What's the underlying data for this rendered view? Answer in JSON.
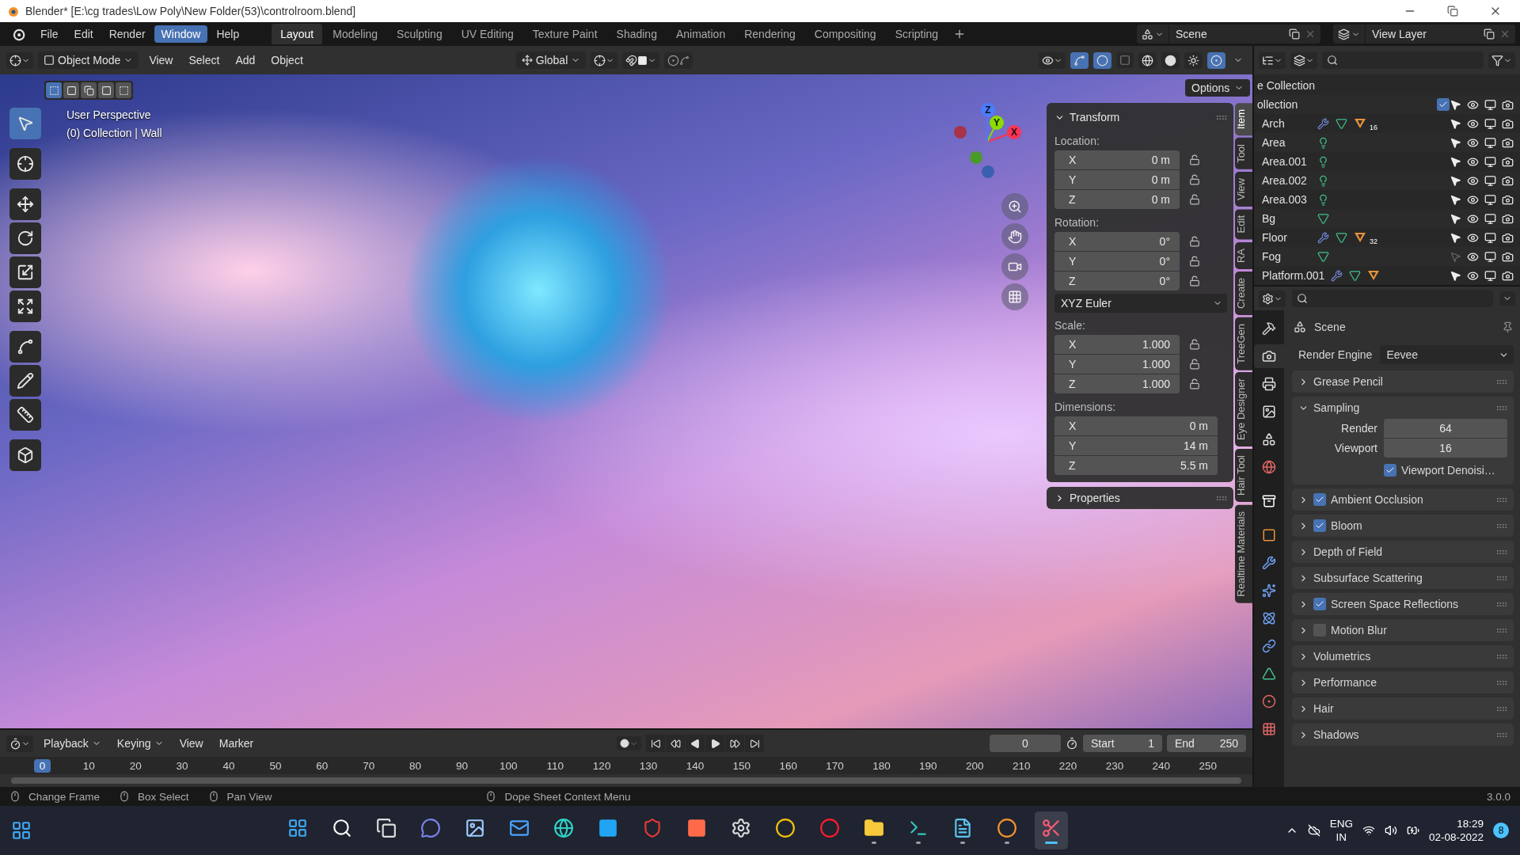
{
  "title_bar": {
    "title": "Blender* [E:\\cg trades\\Low Poly\\New Folder(53)\\controlroom.blend]"
  },
  "menus": [
    {
      "label": "File",
      "selected": false
    },
    {
      "label": "Edit",
      "selected": false
    },
    {
      "label": "Render",
      "selected": false
    },
    {
      "label": "Window",
      "selected": true
    },
    {
      "label": "Help",
      "selected": false
    }
  ],
  "workspaces": [
    {
      "label": "Layout",
      "selected": true
    },
    {
      "label": "Modeling",
      "selected": false
    },
    {
      "label": "Sculpting",
      "selected": false
    },
    {
      "label": "UV Editing",
      "selected": false
    },
    {
      "label": "Texture Paint",
      "selected": false
    },
    {
      "label": "Shading",
      "selected": false
    },
    {
      "label": "Animation",
      "selected": false
    },
    {
      "label": "Rendering",
      "selected": false
    },
    {
      "label": "Compositing",
      "selected": false
    },
    {
      "label": "Scripting",
      "selected": false
    }
  ],
  "scene": "Scene",
  "view_layer": "View Layer",
  "viewport": {
    "mode": "Object Mode",
    "menus": [
      "View",
      "Select",
      "Add",
      "Object"
    ],
    "orientation": "Global",
    "options": "Options",
    "info": [
      "User Perspective",
      "(0) Collection | Wall"
    ],
    "gizmo_axes": [
      "X",
      "Y",
      "Z"
    ],
    "tools": [
      {
        "kind": "select",
        "selected": true
      },
      {
        "kind": "cursor",
        "selected": false
      },
      {
        "kind": "move",
        "selected": false
      },
      {
        "kind": "rotate",
        "selected": false
      },
      {
        "kind": "scale",
        "selected": false
      },
      {
        "kind": "transform",
        "selected": false
      },
      {
        "kind": "annotate_line",
        "selected": false
      },
      {
        "kind": "annotate",
        "selected": false
      },
      {
        "kind": "measure",
        "selected": false
      },
      {
        "kind": "add_cube",
        "selected": false
      }
    ],
    "sidebar_tabs": [
      {
        "label": "Item",
        "selected": true
      },
      {
        "label": "Tool",
        "selected": false
      },
      {
        "label": "View",
        "selected": false
      },
      {
        "label": "Edit",
        "selected": false
      },
      {
        "label": "RA",
        "selected": false
      },
      {
        "label": "Create",
        "selected": false
      },
      {
        "label": "TreeGen",
        "selected": false
      },
      {
        "label": "Eye Designer",
        "selected": false
      },
      {
        "label": "Hair Tool",
        "selected": false
      },
      {
        "label": "Realtime Materials",
        "selected": false
      }
    ],
    "transform": {
      "title": "Transform",
      "expanded": true,
      "groups": [
        {
          "label": "Location:",
          "locks": true,
          "fields": [
            {
              "axis": "X",
              "value": "0 m"
            },
            {
              "axis": "Y",
              "value": "0 m"
            },
            {
              "axis": "Z",
              "value": "0 m"
            }
          ]
        },
        {
          "label": "Rotation:",
          "locks": true,
          "fields": [
            {
              "axis": "X",
              "value": "0°"
            },
            {
              "axis": "Y",
              "value": "0°"
            },
            {
              "axis": "Z",
              "value": "0°"
            }
          ],
          "mode": "XYZ Euler"
        },
        {
          "label": "Scale:",
          "locks": true,
          "fields": [
            {
              "axis": "X",
              "value": "1.000"
            },
            {
              "axis": "Y",
              "value": "1.000"
            },
            {
              "axis": "Z",
              "value": "1.000"
            }
          ]
        },
        {
          "label": "Dimensions:",
          "locks": false,
          "fields": [
            {
              "axis": "X",
              "value": "0 m"
            },
            {
              "axis": "Y",
              "value": "14 m"
            },
            {
              "axis": "Z",
              "value": "5.5 m"
            }
          ]
        }
      ],
      "more": {
        "title": "Properties",
        "expanded": false
      }
    }
  },
  "outliner": {
    "rows": [
      {
        "kind": "scene_collection",
        "name": "e Collection"
      },
      {
        "kind": "collection",
        "name": "ollection",
        "checked": true
      },
      {
        "kind": "mesh",
        "name": "Arch",
        "modifier": true,
        "material": true,
        "material_count": "16",
        "selectable": true
      },
      {
        "kind": "light",
        "name": "Area",
        "selectable": true
      },
      {
        "kind": "light",
        "name": "Area.001",
        "selectable": true
      },
      {
        "kind": "light",
        "name": "Area.002",
        "selectable": true
      },
      {
        "kind": "light",
        "name": "Area.003",
        "selectable": true
      },
      {
        "kind": "mesh",
        "name": "Bg",
        "modifier": false,
        "material": false,
        "selectable": true
      },
      {
        "kind": "mesh",
        "name": "Floor",
        "modifier": true,
        "material": true,
        "material_count": "32",
        "selectable": true
      },
      {
        "kind": "mesh",
        "name": "Fog",
        "modifier": false,
        "material": false,
        "selectable": false
      },
      {
        "kind": "mesh",
        "name": "Platform.001",
        "modifier": true,
        "material": true,
        "selectable": true
      }
    ]
  },
  "properties": {
    "tabs": [
      {
        "kind": "tool",
        "selected": false
      },
      {
        "kind": "render",
        "selected": true
      },
      {
        "kind": "output",
        "selected": false
      },
      {
        "kind": "view_layer",
        "selected": false
      },
      {
        "kind": "scene",
        "selected": false
      },
      {
        "kind": "world",
        "selected": false
      },
      {
        "kind": "collection",
        "selected": false
      },
      {
        "kind": "object",
        "selected": false
      },
      {
        "kind": "modifier",
        "selected": false
      },
      {
        "kind": "particles",
        "selected": false
      },
      {
        "kind": "physics",
        "selected": false
      },
      {
        "kind": "constraints",
        "selected": false
      },
      {
        "kind": "data",
        "selected": false
      },
      {
        "kind": "material",
        "selected": false
      },
      {
        "kind": "texture",
        "selected": false
      }
    ],
    "context": "Scene",
    "engine_label": "Render Engine",
    "engine": "Eevee",
    "panels": [
      {
        "label": "Grease Pencil",
        "kind": "plain",
        "expanded": false
      },
      {
        "label": "Sampling",
        "kind": "plain",
        "expanded": true,
        "fields": [
          {
            "label": "Render",
            "value": "64"
          },
          {
            "label": "Viewport",
            "value": "16"
          }
        ],
        "options": [
          {
            "label": "Viewport Denoisi…",
            "checked": true
          }
        ]
      },
      {
        "label": "Ambient Occlusion",
        "kind": "toggle",
        "checked": true,
        "expanded": false
      },
      {
        "label": "Bloom",
        "kind": "toggle",
        "checked": true,
        "expanded": false
      },
      {
        "label": "Depth of Field",
        "kind": "plain",
        "expanded": false
      },
      {
        "label": "Subsurface Scattering",
        "kind": "plain",
        "expanded": false
      },
      {
        "label": "Screen Space Reflections",
        "kind": "toggle",
        "checked": true,
        "expanded": false
      },
      {
        "label": "Motion Blur",
        "kind": "toggle",
        "checked": false,
        "expanded": false
      },
      {
        "label": "Volumetrics",
        "kind": "plain",
        "expanded": false
      },
      {
        "label": "Performance",
        "kind": "plain",
        "expanded": false
      },
      {
        "label": "Hair",
        "kind": "plain",
        "expanded": false
      },
      {
        "label": "Shadows",
        "kind": "plain",
        "expanded": false
      }
    ]
  },
  "timeline": {
    "menus": [
      {
        "label": "Playback",
        "dropdown": true
      },
      {
        "label": "Keying",
        "dropdown": true
      },
      {
        "label": "View",
        "dropdown": false
      },
      {
        "label": "Marker",
        "dropdown": false
      }
    ],
    "current_frame": "0",
    "start_label": "Start",
    "start": "1",
    "end_label": "End",
    "end": "250",
    "frames": [
      {
        "label": "0",
        "selected": true
      },
      {
        "label": "10",
        "selected": false
      },
      {
        "label": "20",
        "selected": false
      },
      {
        "label": "30",
        "selected": false
      },
      {
        "label": "40",
        "selected": false
      },
      {
        "label": "50",
        "selected": false
      },
      {
        "label": "60",
        "selected": false
      },
      {
        "label": "70",
        "selected": false
      },
      {
        "label": "80",
        "selected": false
      },
      {
        "label": "90",
        "selected": false
      },
      {
        "label": "100",
        "selected": false
      },
      {
        "label": "110",
        "selected": false
      },
      {
        "label": "120",
        "selected": false
      },
      {
        "label": "130",
        "selected": false
      },
      {
        "label": "140",
        "selected": false
      },
      {
        "label": "150",
        "selected": false
      },
      {
        "label": "160",
        "selected": false
      },
      {
        "label": "170",
        "selected": false
      },
      {
        "label": "180",
        "selected": false
      },
      {
        "label": "190",
        "selected": false
      },
      {
        "label": "200",
        "selected": false
      },
      {
        "label": "210",
        "selected": false
      },
      {
        "label": "220",
        "selected": false
      },
      {
        "label": "230",
        "selected": false
      },
      {
        "label": "240",
        "selected": false
      },
      {
        "label": "250",
        "selected": false
      }
    ]
  },
  "status_bar": {
    "hints": [
      "Change Frame",
      "Box Select",
      "Pan View",
      "Dope Sheet Context Menu"
    ],
    "version": "3.0.0"
  },
  "taskbar": {
    "apps": [
      {
        "kind": "start",
        "running": false
      },
      {
        "kind": "search",
        "running": false
      },
      {
        "kind": "task_view",
        "running": false
      },
      {
        "kind": "chat",
        "running": false
      },
      {
        "kind": "photos",
        "running": false
      },
      {
        "kind": "mail",
        "running": false
      },
      {
        "kind": "browser",
        "running": false
      },
      {
        "kind": "learning",
        "running": false
      },
      {
        "kind": "antivirus",
        "running": false
      },
      {
        "kind": "editor",
        "running": false
      },
      {
        "kind": "settings",
        "running": false
      },
      {
        "kind": "web",
        "running": false
      },
      {
        "kind": "opera",
        "running": false
      },
      {
        "kind": "folder",
        "running": true
      },
      {
        "kind": "terminal",
        "running": true
      },
      {
        "kind": "notepad",
        "running": true
      },
      {
        "kind": "blender",
        "running": true
      },
      {
        "kind": "snip",
        "running": true,
        "active": true
      }
    ],
    "language": [
      "ENG",
      "IN"
    ],
    "time": "18:29",
    "date": "02-08-2022",
    "notifications": "8"
  }
}
